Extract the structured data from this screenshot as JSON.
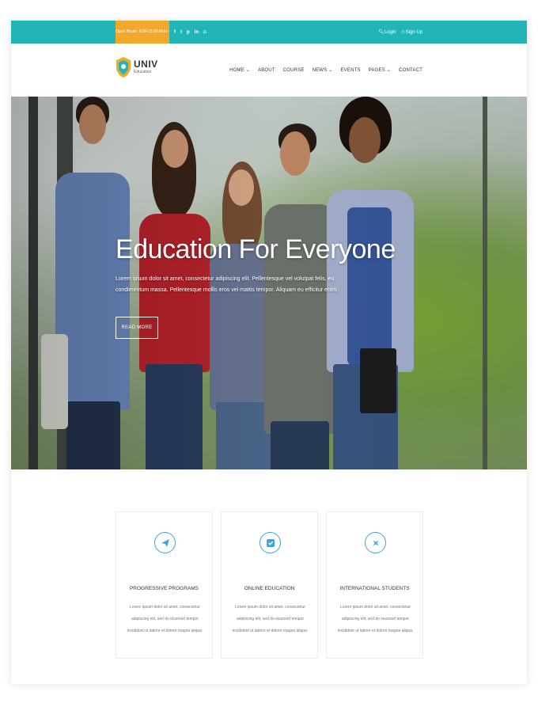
{
  "topbar": {
    "hours": "Open Hours: 9.00-15.00 Mon - Sat",
    "social_icons": [
      "facebook-icon",
      "twitter-icon",
      "pinterest-icon",
      "linkedin-icon",
      "instagram-icon"
    ],
    "social_glyphs": [
      "f",
      "t",
      "p",
      "in",
      "◘"
    ],
    "login": "Login",
    "signup": "Sign Up",
    "color": "#22b5b5",
    "hours_bg": "#f2a92b"
  },
  "header": {
    "brand": "UNIV",
    "tagline": "Education",
    "nav": [
      {
        "label": "HOME",
        "dropdown": true
      },
      {
        "label": "ABOUT",
        "dropdown": false
      },
      {
        "label": "COURSE",
        "dropdown": false
      },
      {
        "label": "NEWS",
        "dropdown": true
      },
      {
        "label": "EVENTS",
        "dropdown": false
      },
      {
        "label": "PAGES",
        "dropdown": true
      },
      {
        "label": "CONTACT",
        "dropdown": false
      }
    ]
  },
  "hero": {
    "title": "Education For Everyone",
    "text": "Lorem ipsum dolor sit amet, consectetur adipiscing elit. Pellentesque vel volutpat felis, eu condimentum massa. Pellentesque mollis eros vel mattis tempor. Aliquam eu efficitur enim.",
    "button": "READ MORE"
  },
  "features": [
    {
      "icon": "paper-plane-icon",
      "title": "PROGRESSIVE PROGRAMS",
      "desc": "Lorem ipsum dolor sit amet, consectetur adipiscing elit, sed do eiusmod tempor incididunt ut labore et dolore magna aliqua."
    },
    {
      "icon": "check-square-icon",
      "title": "ONLINE EDUCATION",
      "desc": "Lorem ipsum dolor sit amet, consectetur adipiscing elit, sed do eiusmod tempor incididunt ut labore et dolore magna aliqua."
    },
    {
      "icon": "airplane-icon",
      "title": "INTERNATIONAL STUDENTS",
      "desc": "Lorem ipsum dolor sit amet, consectetur adipiscing elit, sed do eiusmod tempor incididunt ut labore et dolore magna aliqua."
    }
  ],
  "colors": {
    "accent": "#22b5b5",
    "highlight": "#f2a92b",
    "icon": "#3fa3e0"
  }
}
